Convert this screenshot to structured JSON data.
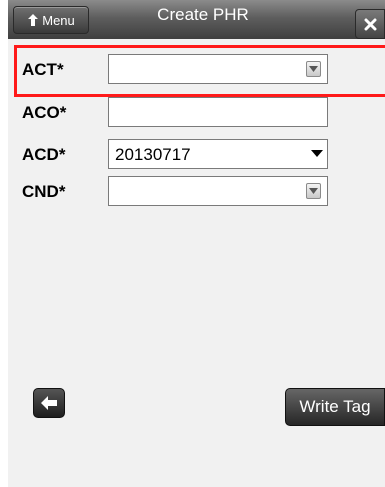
{
  "header": {
    "menu_label": "Menu",
    "title": "Create PHR",
    "close_icon": "close-icon"
  },
  "form": {
    "fields": [
      {
        "label": "ACT*",
        "value": "",
        "control": "combo"
      },
      {
        "label": "ACO*",
        "value": "",
        "control": "text"
      },
      {
        "label": "ACD*",
        "value": "20130717",
        "control": "dropdown"
      },
      {
        "label": "CND*",
        "value": "",
        "control": "combo"
      }
    ]
  },
  "footer": {
    "back_icon": "arrow-left-icon",
    "write_label": "Write Tag"
  },
  "colors": {
    "highlight": "#ff1a1a",
    "titlebar": "#5e5e5e",
    "background": "#f1f1f1"
  }
}
